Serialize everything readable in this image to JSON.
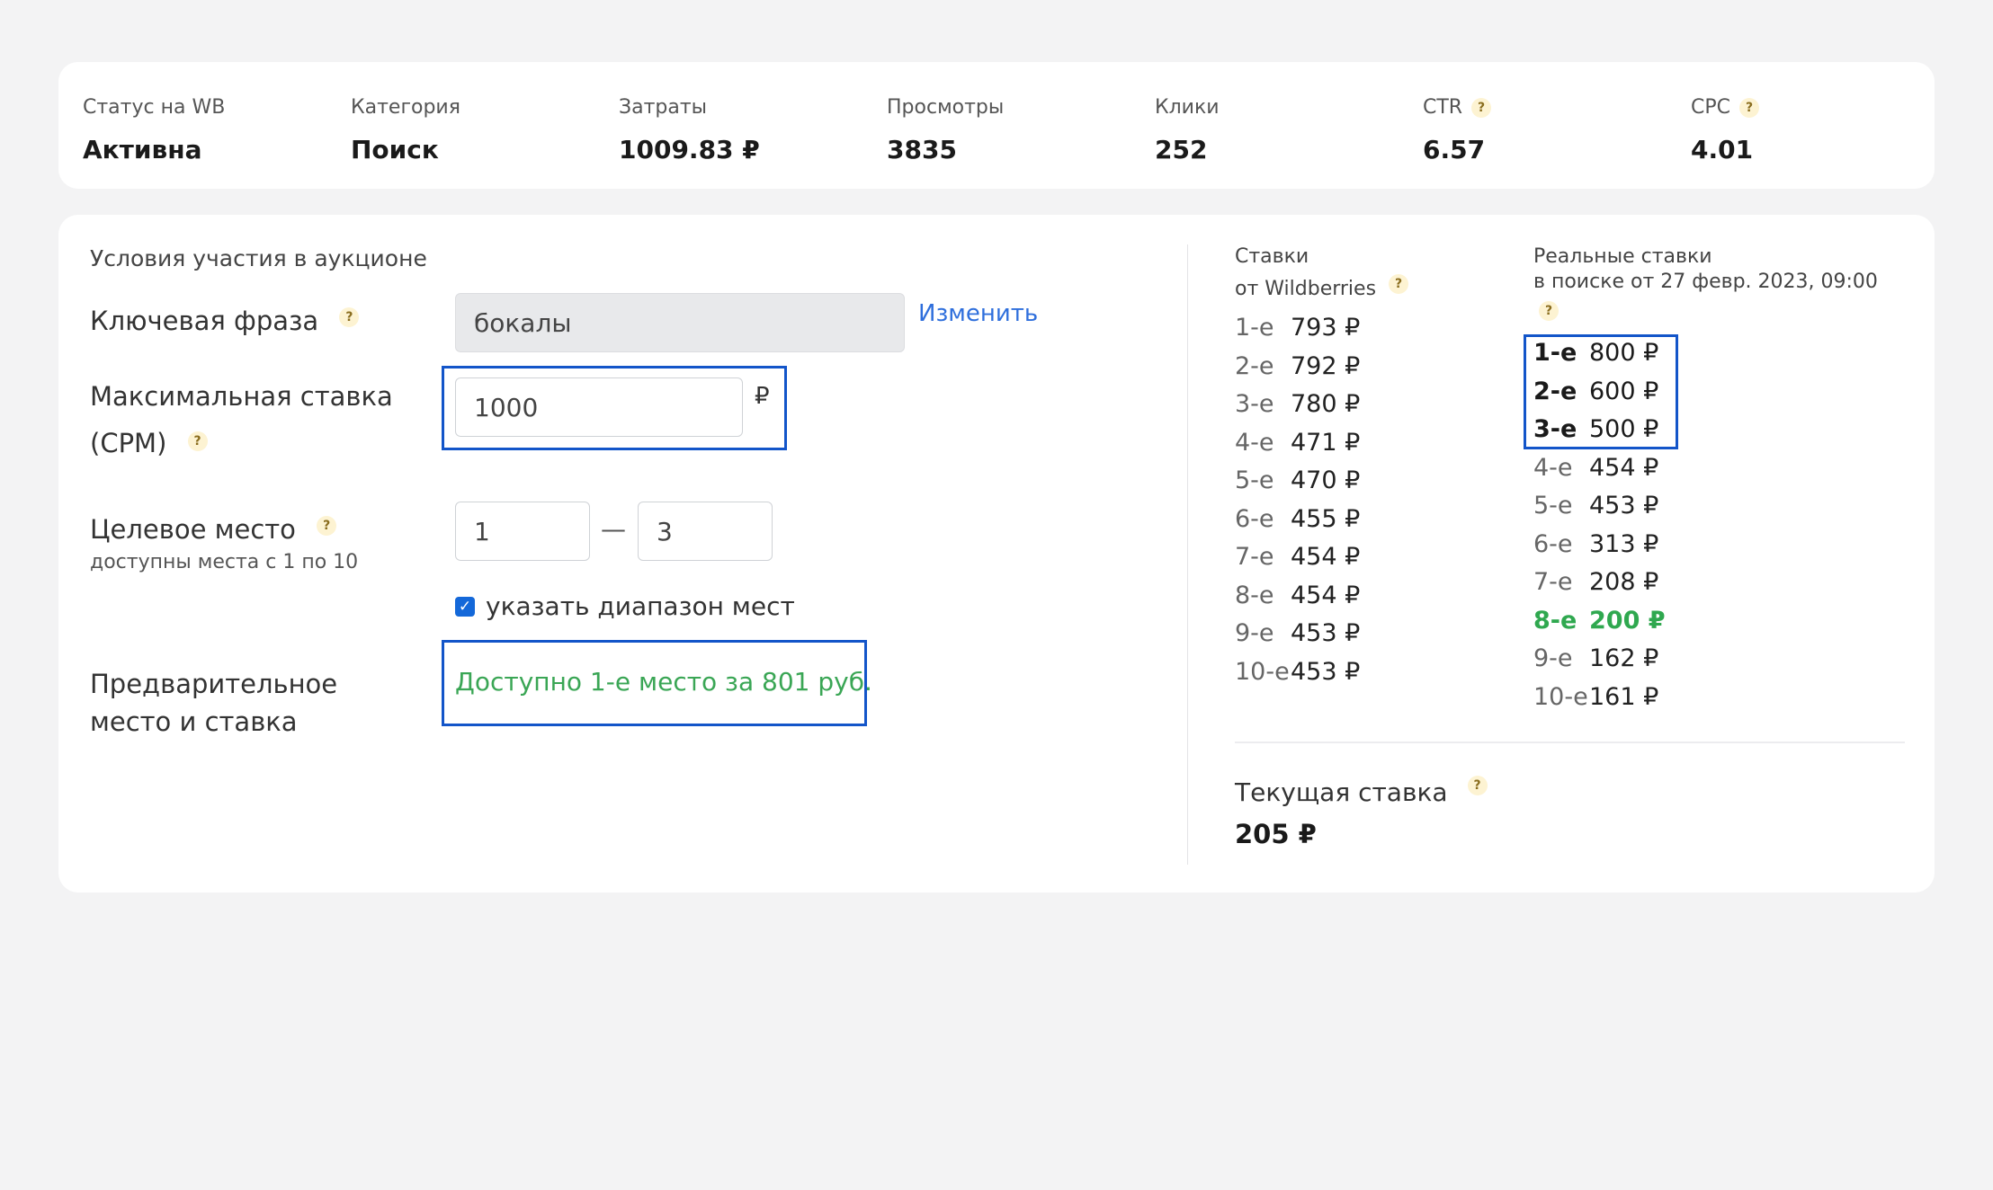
{
  "stats": [
    {
      "label": "Статус на WB",
      "value": "Активна",
      "help": false
    },
    {
      "label": "Категория",
      "value": "Поиск",
      "help": false
    },
    {
      "label": "Затраты",
      "value": "1009.83 ₽",
      "help": false
    },
    {
      "label": "Просмотры",
      "value": "3835",
      "help": false
    },
    {
      "label": "Клики",
      "value": "252",
      "help": false
    },
    {
      "label": "CTR",
      "value": "6.57",
      "help": true
    },
    {
      "label": "CPC",
      "value": "4.01",
      "help": true
    }
  ],
  "help_glyph": "?",
  "auction": {
    "section_title": "Условия участия в аукционе",
    "keyword_label": "Ключевая фраза",
    "keyword_value": "бокалы",
    "change_link": "Изменить",
    "max_bid_label_line1": "Максимальная ставка",
    "max_bid_label_line2": "(CPM)",
    "max_bid_value": "1000",
    "currency": "₽",
    "target_label": "Целевое место",
    "target_sublabel": "доступны места с 1 по 10",
    "target_from": "1",
    "target_dash": "—",
    "target_to": "3",
    "range_checkbox_label": "указать диапазон мест",
    "range_checked": true,
    "preview_label_line1": "Предварительное",
    "preview_label_line2": "место и ставка",
    "preview_text": "Доступно 1-е место за 801 руб."
  },
  "wb_rates": {
    "title_line1": "Ставки",
    "title_line2": "от Wildberries",
    "rows": [
      {
        "place": "1-е",
        "value": "793 ₽"
      },
      {
        "place": "2-е",
        "value": "792 ₽"
      },
      {
        "place": "3-е",
        "value": "780 ₽"
      },
      {
        "place": "4-е",
        "value": "471 ₽"
      },
      {
        "place": "5-е",
        "value": "470 ₽"
      },
      {
        "place": "6-е",
        "value": "455 ₽"
      },
      {
        "place": "7-е",
        "value": "454 ₽"
      },
      {
        "place": "8-е",
        "value": "454 ₽"
      },
      {
        "place": "9-е",
        "value": "453 ₽"
      },
      {
        "place": "10-е",
        "value": "453 ₽"
      }
    ]
  },
  "real_rates": {
    "title_line1": "Реальные ставки",
    "title_line2": "в поиске от 27 февр. 2023, 09:00",
    "rows": [
      {
        "place": "1-е",
        "value": "800 ₽",
        "style": "bold"
      },
      {
        "place": "2-е",
        "value": "600 ₽",
        "style": "bold"
      },
      {
        "place": "3-е",
        "value": "500 ₽",
        "style": "bold"
      },
      {
        "place": "4-е",
        "value": "454 ₽",
        "style": "normal"
      },
      {
        "place": "5-е",
        "value": "453 ₽",
        "style": "normal"
      },
      {
        "place": "6-е",
        "value": "313 ₽",
        "style": "normal"
      },
      {
        "place": "7-е",
        "value": "208 ₽",
        "style": "normal"
      },
      {
        "place": "8-е",
        "value": "200 ₽",
        "style": "green"
      },
      {
        "place": "9-е",
        "value": "162 ₽",
        "style": "normal"
      },
      {
        "place": "10-е",
        "value": "161 ₽",
        "style": "normal"
      }
    ]
  },
  "current_bid": {
    "label": "Текущая ставка",
    "value": "205 ₽"
  },
  "colors": {
    "accent_frame": "#1355c9",
    "link": "#2f6fdc",
    "green": "#2fa84f",
    "help_bg": "#fdf3d2"
  }
}
